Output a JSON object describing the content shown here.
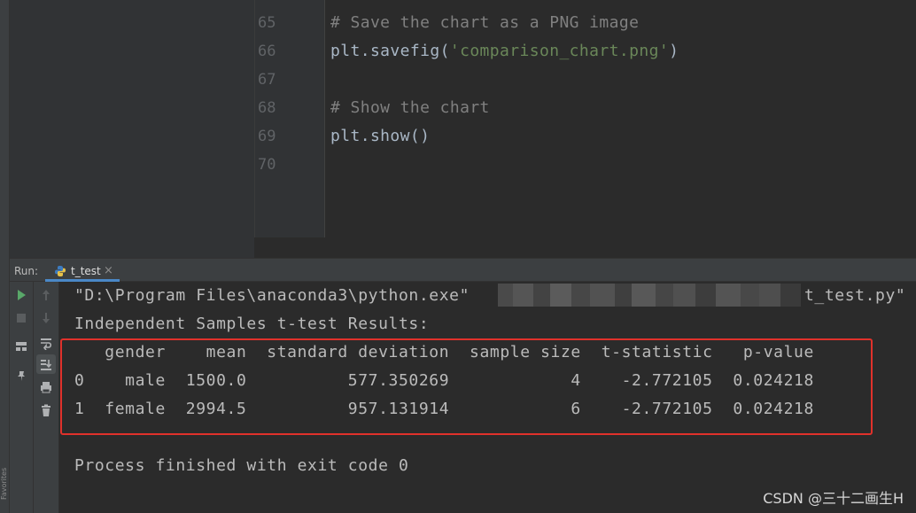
{
  "editor": {
    "lines": [
      {
        "num": "65",
        "comment": "# Save the chart as a PNG image"
      },
      {
        "num": "66",
        "pre": "plt.savefig(",
        "str": "'comparison_chart.png'",
        "post": ")"
      },
      {
        "num": "67"
      },
      {
        "num": "68",
        "comment": "# Show the chart"
      },
      {
        "num": "69",
        "pre": "plt.show()"
      },
      {
        "num": "70"
      }
    ]
  },
  "run": {
    "label": "Run:",
    "tab_label": "t_test",
    "tab_close": "×"
  },
  "favorites_label": "Favorites",
  "console": {
    "cmd_left": "\"D:\\Program Files\\anaconda3\\python.exe\"",
    "cmd_right": "t_test.py\"",
    "results_title": "Independent Samples t-test Results:",
    "table_header": "   gender    mean  standard deviation  sample size  t-statistic   p-value",
    "table_rows": [
      "0    male  1500.0          577.350269            4    -2.772105  0.024218",
      "1  female  2994.5          957.131914            6    -2.772105  0.024218"
    ],
    "exit_message": "Process finished with exit code 0"
  },
  "watermark": "CSDN @三十二画生H",
  "colors": {
    "accent": "#4a88c7",
    "highlight_box": "#e0312b",
    "run_green": "#59a869"
  }
}
